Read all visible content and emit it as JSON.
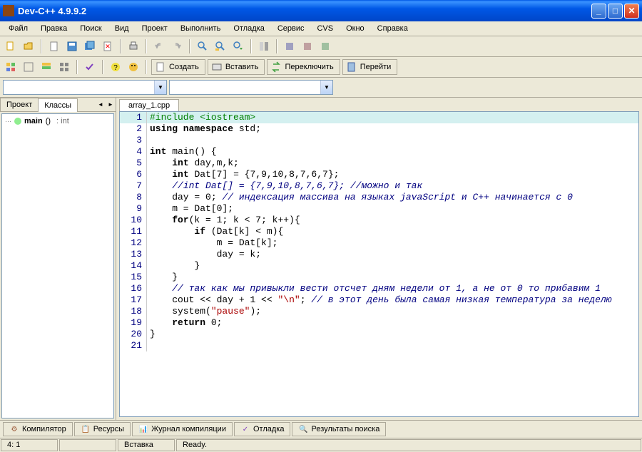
{
  "titlebar": {
    "title": "Dev-C++ 4.9.9.2"
  },
  "menu": [
    "Файл",
    "Правка",
    "Поиск",
    "Вид",
    "Проект",
    "Выполнить",
    "Отладка",
    "Сервис",
    "CVS",
    "Окно",
    "Справка"
  ],
  "toolbar2": {
    "create": "Создать",
    "insert": "Вставить",
    "switch": "Переключить",
    "goto": "Перейти"
  },
  "sidebar": {
    "tabs": [
      "Проект",
      "Классы"
    ],
    "tree": {
      "main_label": "main",
      "main_paren": "()",
      "main_ret": ": int"
    }
  },
  "editor": {
    "tab": "array_1.cpp",
    "lines": [
      [
        {
          "t": "#include <iostream>",
          "c": "pp"
        }
      ],
      [
        {
          "t": "using namespace ",
          "c": "kw"
        },
        {
          "t": "std;",
          "c": ""
        }
      ],
      [],
      [
        {
          "t": "int ",
          "c": "kw"
        },
        {
          "t": "main() {",
          "c": ""
        }
      ],
      [
        {
          "t": "    ",
          "c": ""
        },
        {
          "t": "int ",
          "c": "kw"
        },
        {
          "t": "day,m,k;",
          "c": ""
        }
      ],
      [
        {
          "t": "    ",
          "c": ""
        },
        {
          "t": "int ",
          "c": "kw"
        },
        {
          "t": "Dat[",
          "c": ""
        },
        {
          "t": "7",
          "c": "num"
        },
        {
          "t": "] = {",
          "c": ""
        },
        {
          "t": "7",
          "c": "num"
        },
        {
          "t": ",",
          "c": ""
        },
        {
          "t": "9",
          "c": "num"
        },
        {
          "t": ",",
          "c": ""
        },
        {
          "t": "10",
          "c": "num"
        },
        {
          "t": ",",
          "c": ""
        },
        {
          "t": "8",
          "c": "num"
        },
        {
          "t": ",",
          "c": ""
        },
        {
          "t": "7",
          "c": "num"
        },
        {
          "t": ",",
          "c": ""
        },
        {
          "t": "6",
          "c": "num"
        },
        {
          "t": ",",
          "c": ""
        },
        {
          "t": "7",
          "c": "num"
        },
        {
          "t": "};",
          "c": ""
        }
      ],
      [
        {
          "t": "    ",
          "c": ""
        },
        {
          "t": "//int Dat[] = {7,9,10,8,7,6,7}; //можно и так",
          "c": "cm"
        }
      ],
      [
        {
          "t": "    day = ",
          "c": ""
        },
        {
          "t": "0",
          "c": "num"
        },
        {
          "t": "; ",
          "c": ""
        },
        {
          "t": "// индексация массива на языках javaScript и C++ начинается с 0",
          "c": "cm"
        }
      ],
      [
        {
          "t": "    m = Dat[",
          "c": ""
        },
        {
          "t": "0",
          "c": "num"
        },
        {
          "t": "];",
          "c": ""
        }
      ],
      [
        {
          "t": "    ",
          "c": ""
        },
        {
          "t": "for",
          "c": "kw"
        },
        {
          "t": "(k = ",
          "c": ""
        },
        {
          "t": "1",
          "c": "num"
        },
        {
          "t": "; k < ",
          "c": ""
        },
        {
          "t": "7",
          "c": "num"
        },
        {
          "t": "; k++){",
          "c": ""
        }
      ],
      [
        {
          "t": "        ",
          "c": ""
        },
        {
          "t": "if ",
          "c": "kw"
        },
        {
          "t": "(Dat[k] < m){",
          "c": ""
        }
      ],
      [
        {
          "t": "            m = Dat[k];",
          "c": ""
        }
      ],
      [
        {
          "t": "            day = k;",
          "c": ""
        }
      ],
      [
        {
          "t": "        }",
          "c": ""
        }
      ],
      [
        {
          "t": "    }",
          "c": ""
        }
      ],
      [
        {
          "t": "    ",
          "c": ""
        },
        {
          "t": "// так как мы привыкли вести отсчет дням недели от 1, а не от 0 то прибавим 1",
          "c": "cm"
        }
      ],
      [
        {
          "t": "    cout << day + ",
          "c": ""
        },
        {
          "t": "1",
          "c": "num"
        },
        {
          "t": " << ",
          "c": ""
        },
        {
          "t": "\"\\n\"",
          "c": "str"
        },
        {
          "t": "; ",
          "c": ""
        },
        {
          "t": "// в этот день была самая низкая температура за неделю",
          "c": "cm"
        }
      ],
      [
        {
          "t": "    system(",
          "c": ""
        },
        {
          "t": "\"pause\"",
          "c": "str"
        },
        {
          "t": ");",
          "c": ""
        }
      ],
      [
        {
          "t": "    ",
          "c": ""
        },
        {
          "t": "return ",
          "c": "kw"
        },
        {
          "t": "0",
          "c": "num"
        },
        {
          "t": ";",
          "c": ""
        }
      ],
      [
        {
          "t": "}",
          "c": ""
        }
      ],
      []
    ]
  },
  "bottomtabs": [
    "Компилятор",
    "Ресурсы",
    "Журнал компиляции",
    "Отладка",
    "Результаты поиска"
  ],
  "status": {
    "pos": "4: 1",
    "mode": "Вставка",
    "state": "Ready."
  }
}
